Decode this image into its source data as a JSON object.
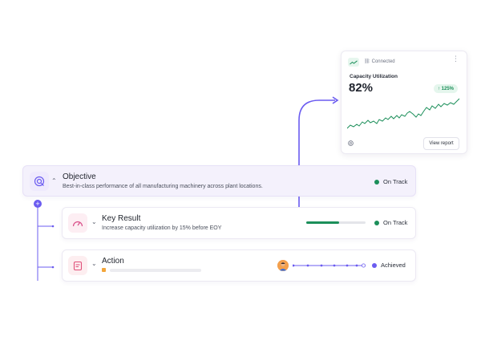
{
  "capacity_card": {
    "connected_label": "Connected",
    "title": "Capacity Utilization",
    "value": "82%",
    "delta": "↑ 125%",
    "view_report_label": "View report",
    "colors": {
      "accent": "#1c8f5a",
      "chip": "#e5f6ed"
    }
  },
  "objective": {
    "title": "Objective",
    "description": "Best-in-class performance of all manufacturing machinery across plant locations.",
    "status": "On Track",
    "status_color": "#1c8f5a"
  },
  "key_result": {
    "title": "Key Result",
    "description": "Increase capacity utilization by 15% before EOY",
    "status": "On Track",
    "status_color": "#1c8f5a",
    "progress": 0.55
  },
  "action": {
    "title": "Action",
    "status": "Achieved",
    "status_color": "#6b5cf0"
  },
  "colors": {
    "brand_purple": "#6b5cf0",
    "green": "#1c8f5a"
  }
}
